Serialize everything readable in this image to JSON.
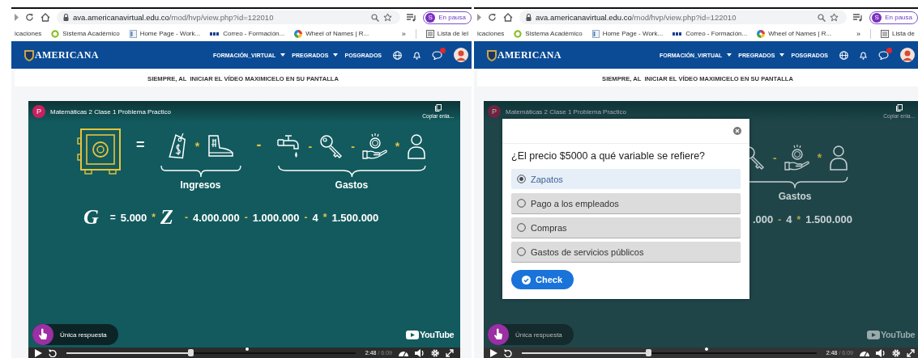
{
  "panes": [
    {
      "browser": {
        "host": "ava.americanavirtual.edu.co",
        "path": "/mod/hvp/view.php?id=122010",
        "profile_initial": "S",
        "profile_status": "En pausa",
        "bookmarks": [
          {
            "label": "icaciones",
            "kind": "plain"
          },
          {
            "label": "Sistema Académico",
            "kind": "circle"
          },
          {
            "label": "Home Page - Work...",
            "kind": "page"
          },
          {
            "label": "Correo - Formación...",
            "kind": "mail"
          },
          {
            "label": "Wheel of Names | R...",
            "kind": "wheel"
          }
        ],
        "overflow": "»",
        "reading_list": "Lista de lel"
      },
      "site": {
        "logo": "AMERICANA",
        "nav": [
          {
            "label": "FORMACIÓN_VIRTUAL",
            "dropdown": true
          },
          {
            "label": "PREGRADOS",
            "dropdown": true
          },
          {
            "label": "POSGRADOS",
            "dropdown": false
          }
        ]
      },
      "notice": "SIEMPRE, AL  INICIAR EL VÍDEO MAXIMICELO EN SU PANTALLA",
      "video": {
        "dimmed": false,
        "avatar": "P",
        "title": "Matemáticas 2 Clase 1 Problema Practico",
        "copy_label": "Copiar enla...",
        "equation": {
          "parts": [
            {
              "kind": "safe"
            },
            {
              "kind": "op",
              "text": "=",
              "accent": false
            },
            {
              "kind": "group",
              "label": "Ingresos",
              "items": [
                {
                  "kind": "tag"
                },
                {
                  "kind": "op",
                  "text": "*",
                  "accent": true
                },
                {
                  "kind": "shoe"
                }
              ]
            },
            {
              "kind": "op",
              "text": "-",
              "accent": true
            },
            {
              "kind": "group",
              "label": "Gastos",
              "items": [
                {
                  "kind": "faucet"
                },
                {
                  "kind": "op",
                  "text": "-",
                  "accent": true
                },
                {
                  "kind": "key"
                },
                {
                  "kind": "op",
                  "text": "-",
                  "accent": true
                },
                {
                  "kind": "coin"
                },
                {
                  "kind": "op",
                  "text": "*",
                  "accent": true
                },
                {
                  "kind": "person"
                }
              ]
            }
          ],
          "formula": [
            {
              "kind": "var",
              "text": "G"
            },
            {
              "kind": "op",
              "text": "=",
              "accent": false
            },
            {
              "kind": "num",
              "text": "5.000"
            },
            {
              "kind": "op",
              "text": "*",
              "accent": true
            },
            {
              "kind": "var",
              "text": "Z"
            },
            {
              "kind": "op",
              "text": "-",
              "accent": true
            },
            {
              "kind": "num",
              "text": "4.000.000"
            },
            {
              "kind": "op",
              "text": "-",
              "accent": true
            },
            {
              "kind": "num",
              "text": "1.000.000"
            },
            {
              "kind": "op",
              "text": "-",
              "accent": true
            },
            {
              "kind": "num",
              "text": "4"
            },
            {
              "kind": "op",
              "text": "*",
              "accent": true
            },
            {
              "kind": "num",
              "text": "1.500.000"
            }
          ]
        },
        "badge": "Única respuesta",
        "youtube": "YouTube",
        "progress": {
          "level": 0.43
        },
        "time": "2:48",
        "duration": "/ 6:09"
      }
    },
    {
      "browser": {
        "host": "ava.americanavirtual.edu.co",
        "path": "/mod/hvp/view.php?id=122010",
        "profile_initial": "S",
        "profile_status": "En pausa",
        "bookmarks": [
          {
            "label": "icaciones",
            "kind": "plain"
          },
          {
            "label": "Sistema Académico",
            "kind": "circle"
          },
          {
            "label": "Home Page - Work...",
            "kind": "page"
          },
          {
            "label": "Correo - Formación...",
            "kind": "mail"
          },
          {
            "label": "Wheel of Names | R...",
            "kind": "wheel"
          }
        ],
        "overflow": "»",
        "reading_list": "Lista de"
      },
      "site": {
        "logo": "AMERICANA",
        "nav": [
          {
            "label": "FORMACIÓN_VIRTUAL",
            "dropdown": true
          },
          {
            "label": "PREGRADOS",
            "dropdown": true
          },
          {
            "label": "POSGRADOS",
            "dropdown": false
          }
        ]
      },
      "notice": "SIEMPRE, AL  INICIAR EL VÍDEO MAXIMICELO EN SU PANTALLA",
      "video": {
        "dimmed": true,
        "avatar": "P",
        "title": "Matemáticas 2 Clase 1 Problema Practico",
        "copy_label": "Copiar enla...",
        "equation": {
          "parts": [
            {
              "kind": "group",
              "label": "Gastos",
              "items": [
                {
                  "kind": "key"
                },
                {
                  "kind": "op",
                  "text": "-",
                  "accent": true
                },
                {
                  "kind": "coin"
                },
                {
                  "kind": "op",
                  "text": "*",
                  "accent": true
                },
                {
                  "kind": "person"
                }
              ]
            }
          ],
          "formula": [
            {
              "kind": "num",
              "text": ".000"
            },
            {
              "kind": "op",
              "text": "-",
              "accent": true
            },
            {
              "kind": "num",
              "text": "4"
            },
            {
              "kind": "op",
              "text": "*",
              "accent": true
            },
            {
              "kind": "num",
              "text": "1.500.000"
            }
          ]
        },
        "quiz": {
          "question": "¿El precio $5000 a qué variable se refiere?",
          "options": [
            {
              "label": "Zapatos",
              "selected": true
            },
            {
              "label": "Pago a los empleados",
              "selected": false
            },
            {
              "label": "Compras",
              "selected": false
            },
            {
              "label": "Gastos de servicios públicos",
              "selected": false
            }
          ],
          "button": "Check"
        },
        "badge": "Única respuesta",
        "youtube": "YouTube",
        "progress": {
          "level": 0.43
        },
        "time": "2:48",
        "duration": "/ 6:09"
      }
    }
  ]
}
